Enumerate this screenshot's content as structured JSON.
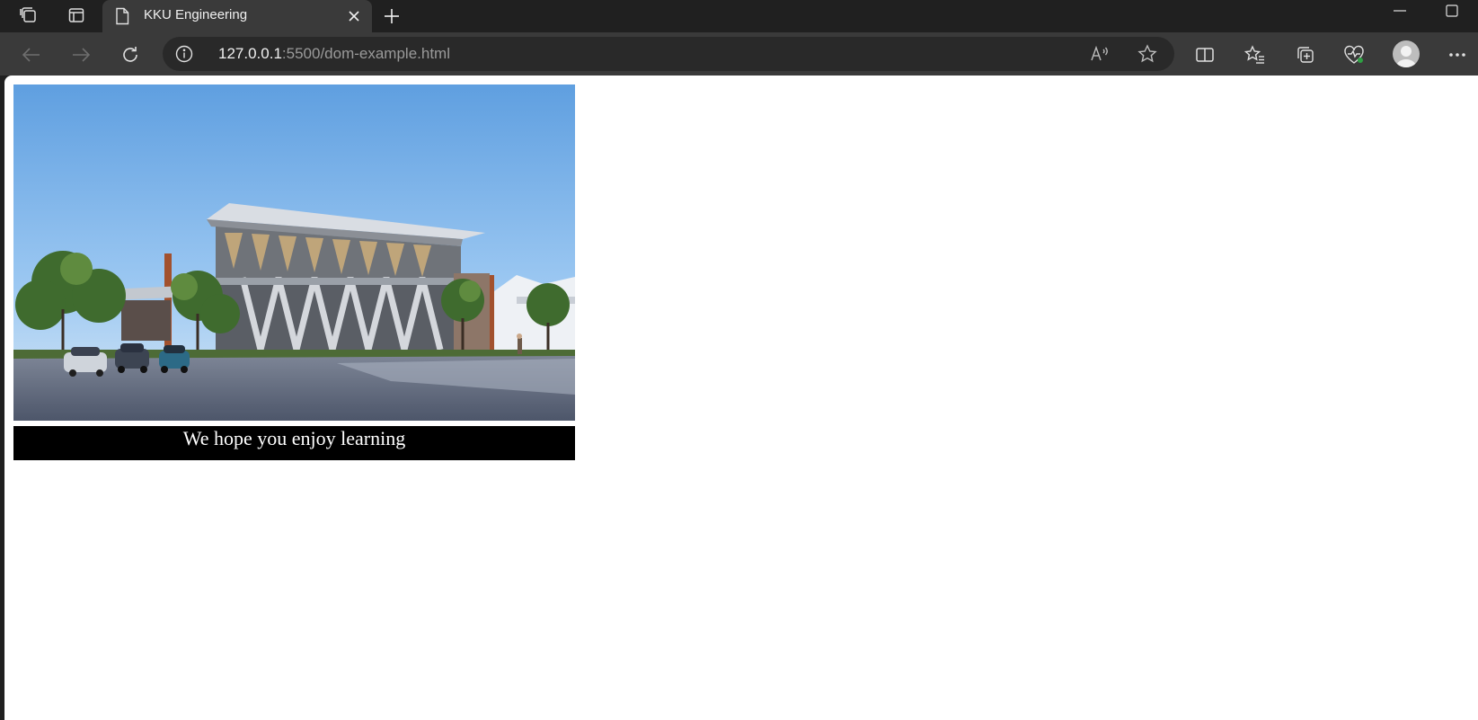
{
  "browser": {
    "tab_title": "KKU Engineering",
    "url_host": "127.0.0.1",
    "url_rest": ":5500/dom-example.html",
    "icons": [
      "workspaces-icon",
      "tab-actions-icon",
      "page-icon",
      "close-icon",
      "new-tab-icon",
      "minimize-icon",
      "maximize-icon",
      "back-icon",
      "forward-icon",
      "refresh-icon",
      "info-icon",
      "read-aloud-icon",
      "favorite-star-icon",
      "split-screen-icon",
      "favorites-icon",
      "collections-icon",
      "browser-essentials-icon",
      "profile-avatar",
      "more-icon"
    ]
  },
  "page": {
    "caption": "We hope you enjoy learning",
    "image_description": "KKU engineering building render"
  },
  "colors": {
    "chrome_dark": "#202020",
    "toolbar": "#3a3a3a",
    "address_bg": "#292929",
    "caption_bg": "#000000",
    "caption_text": "#ffffff"
  }
}
